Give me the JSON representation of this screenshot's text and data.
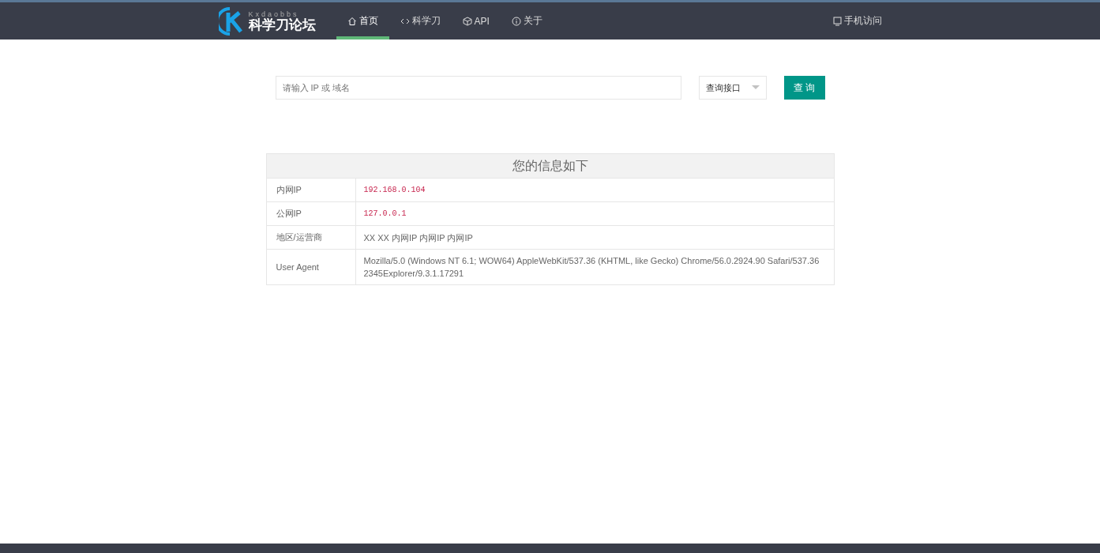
{
  "header": {
    "logo": {
      "subtitle": "Kxdaobbs",
      "title": "科学刀论坛"
    },
    "nav": [
      {
        "label": "首页",
        "kind": "home",
        "selected": true
      },
      {
        "label": "科学刀",
        "kind": "code",
        "selected": false
      },
      {
        "label": "API",
        "kind": "cube",
        "selected": false
      },
      {
        "label": "关于",
        "kind": "info",
        "selected": false
      }
    ],
    "mobile_link": {
      "label": "手机访问"
    }
  },
  "search": {
    "placeholder": "请输入 IP 或 域名",
    "select": "查询接口",
    "button": "查 询"
  },
  "info_table": {
    "title": "您的信息如下",
    "rows": [
      {
        "label": "内网IP",
        "value": "192.168.0.104",
        "kind": "code"
      },
      {
        "label": "公网IP",
        "value": "127.0.0.1",
        "kind": "code"
      },
      {
        "label": "地区/运营商",
        "value": "XX XX 内网IP 内网IP 内网IP",
        "kind": "text"
      },
      {
        "label": "User Agent",
        "value": "Mozilla/5.0 (Windows NT 6.1; WOW64) AppleWebKit/537.36 (KHTML, like Gecko) Chrome/56.0.2924.90 Safari/537.36 2345Explorer/9.3.1.17291",
        "kind": "text"
      }
    ]
  }
}
